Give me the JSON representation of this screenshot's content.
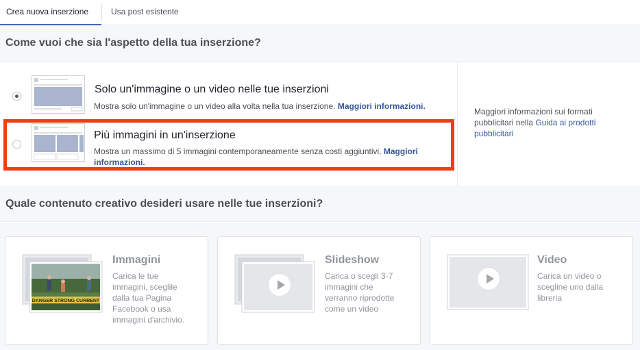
{
  "tabs": {
    "create_new": "Crea nuova inserzione",
    "use_existing": "Usa post esistente"
  },
  "format_section": {
    "heading": "Come vuoi che sia l'aspetto della tua inserzione?",
    "options": [
      {
        "title": "Solo un'immagine o un video nelle tue inserzioni",
        "description": "Mostra solo un'immagine o un video alla volta nella tua inserzione.",
        "link": "Maggiori informazioni.",
        "selected": true
      },
      {
        "title": "Più immagini in un'inserzione",
        "description": "Mostra un massimo di 5 immagini contemporaneamente senza costi aggiuntivi.",
        "link": "Maggiori informazioni.",
        "selected": false
      }
    ],
    "side_info": {
      "text": "Maggiori informazioni sui formati pubblicitari nella",
      "link": "Guida ai prodotti pubblicitari"
    }
  },
  "creative_section": {
    "heading": "Quale contenuto creativo desideri usare nelle tue inserzioni?",
    "cards": [
      {
        "title": "Immagini",
        "description": "Carica le tue immagini, sceglile dalla tua Pagina Facebook o usa immagini d'archivio."
      },
      {
        "title": "Slideshow",
        "description": "Carica o scegli 3-7 immagini che verranno riprodotte come un video"
      },
      {
        "title": "Video",
        "description": "Carica un video o scegline uno dalla libreria"
      }
    ],
    "sample_image_sign": "DANGER STRONG CURRENT"
  },
  "colors": {
    "accent": "#4267b2",
    "link": "#365899",
    "highlight": "#f43b12"
  }
}
